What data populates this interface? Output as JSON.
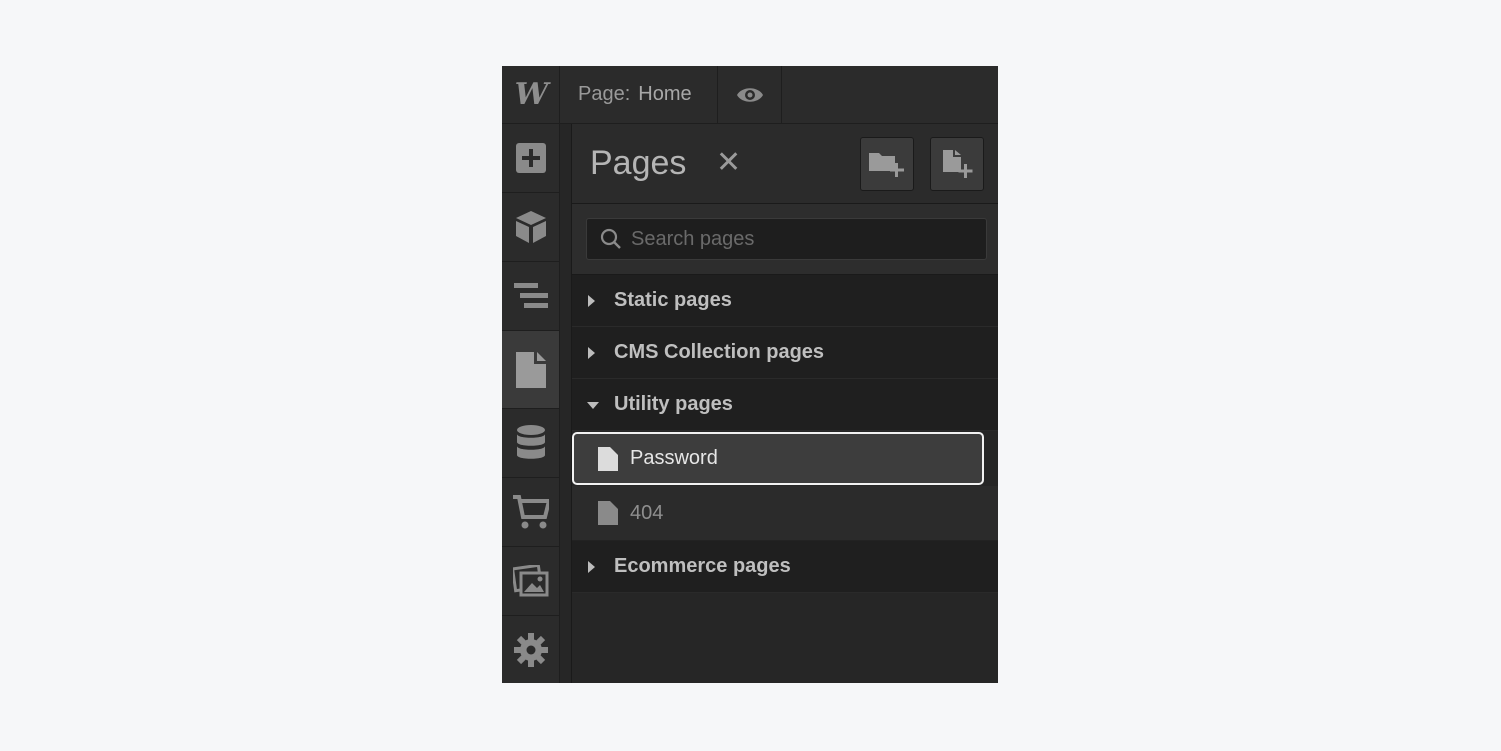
{
  "topbar": {
    "logo": "W",
    "page_prefix": "Page:",
    "page_name": "Home",
    "preview_icon": "eye-icon"
  },
  "rail": {
    "items": [
      {
        "icon": "add-icon",
        "active": false
      },
      {
        "icon": "components-icon",
        "active": false
      },
      {
        "icon": "navigator-icon",
        "active": false
      },
      {
        "icon": "pages-icon",
        "active": true
      },
      {
        "icon": "cms-database-icon",
        "active": false
      },
      {
        "icon": "ecommerce-cart-icon",
        "active": false
      },
      {
        "icon": "assets-icon",
        "active": false
      },
      {
        "icon": "settings-gear-icon",
        "active": false
      }
    ]
  },
  "panel": {
    "title": "Pages",
    "close_glyph": "✕",
    "new_folder_icon": "add-folder-icon",
    "new_page_icon": "add-page-icon",
    "search": {
      "placeholder": "Search pages",
      "value": ""
    },
    "folders": {
      "static": "Static pages",
      "cms": "CMS Collection pages",
      "utility": "Utility pages",
      "ecommerce": "Ecommerce pages"
    },
    "utility_pages": {
      "password": "Password",
      "not_found": "404"
    }
  },
  "colors": {
    "background": "#f6f7f9",
    "panel": "#2b2b2b",
    "selected_border": "#f2f2f2"
  }
}
